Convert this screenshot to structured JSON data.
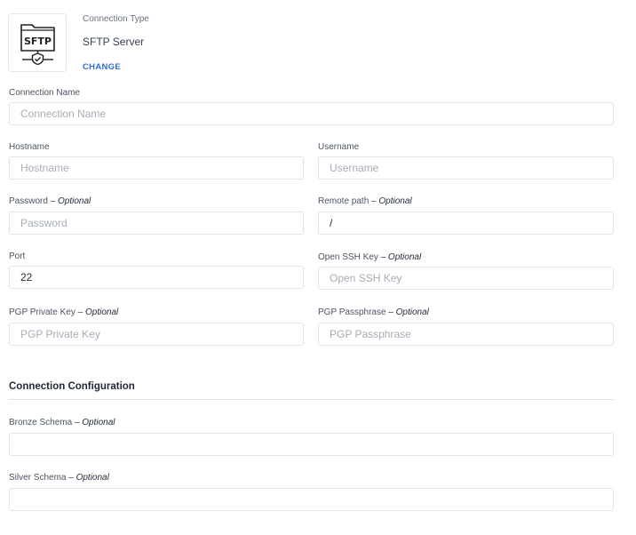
{
  "connection_type": {
    "caption": "Connection Type",
    "value": "SFTP Server",
    "change_label": "CHANGE",
    "icon": "sftp-server-icon",
    "icon_text": "SFTP"
  },
  "fields": {
    "connection_name": {
      "label": "Connection Name",
      "placeholder": "Connection Name",
      "value": ""
    },
    "hostname": {
      "label": "Hostname",
      "placeholder": "Hostname",
      "value": ""
    },
    "username": {
      "label": "Username",
      "placeholder": "Username",
      "value": ""
    },
    "password": {
      "label": "Password",
      "optional": "– Optional",
      "placeholder": "Password",
      "value": ""
    },
    "remote_path": {
      "label": "Remote path",
      "optional": "– Optional",
      "placeholder": "",
      "value": "/"
    },
    "port": {
      "label": "Port",
      "placeholder": "",
      "value": "22"
    },
    "open_ssh_key": {
      "label": "Open SSH Key",
      "optional": "– Optional",
      "placeholder": "Open SSH Key",
      "value": ""
    },
    "pgp_private_key": {
      "label": "PGP Private Key",
      "optional": "– Optional",
      "placeholder": "PGP Private Key",
      "value": ""
    },
    "pgp_passphrase": {
      "label": "PGP Passphrase",
      "optional": "– Optional",
      "placeholder": "PGP Passphrase",
      "value": ""
    }
  },
  "configuration": {
    "title": "Connection Configuration",
    "bronze_schema": {
      "label": "Bronze Schema",
      "optional": "– Optional",
      "value": ""
    },
    "silver_schema": {
      "label": "Silver Schema",
      "optional": "– Optional",
      "value": ""
    }
  },
  "colors": {
    "accent": "#2f6fd6",
    "border": "#e1e4ea",
    "placeholder": "#a7adb7"
  }
}
